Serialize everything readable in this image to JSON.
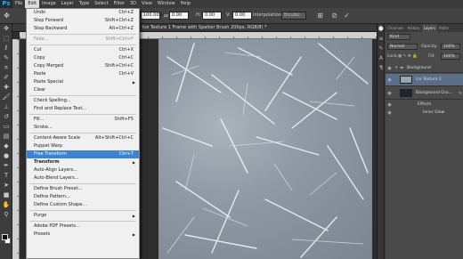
{
  "app": {
    "logo": "Ps"
  },
  "menubar": [
    "File",
    "Edit",
    "Image",
    "Layer",
    "Type",
    "Select",
    "Filter",
    "3D",
    "View",
    "Window",
    "Help"
  ],
  "options": {
    "w_value": "100.00%",
    "angle_value": "0.00",
    "h_value": "0.00",
    "h_label": "H:",
    "v_value": "0.00",
    "v_label": "V:",
    "interpolation_label": "Interpolation:",
    "interpolation_value": "Bicubic"
  },
  "document": {
    "tab_title": "Ice Texture 1  Frame with Spatter Brush 200px, RGB/8) *",
    "close_glyph": "×"
  },
  "edit_menu": {
    "items": [
      {
        "label": "Undo",
        "shortcut": "Ctrl+Z",
        "state": "normal"
      },
      {
        "label": "Step Forward",
        "shortcut": "Shift+Ctrl+Z",
        "state": "normal"
      },
      {
        "label": "Step Backward",
        "shortcut": "Alt+Ctrl+Z",
        "state": "normal"
      },
      {
        "sep": true
      },
      {
        "label": "Fade...",
        "shortcut": "Shift+Ctrl+F",
        "state": "disabled"
      },
      {
        "sep": true
      },
      {
        "label": "Cut",
        "shortcut": "Ctrl+X",
        "state": "normal"
      },
      {
        "label": "Copy",
        "shortcut": "Ctrl+C",
        "state": "normal"
      },
      {
        "label": "Copy Merged",
        "shortcut": "Shift+Ctrl+C",
        "state": "normal"
      },
      {
        "label": "Paste",
        "shortcut": "Ctrl+V",
        "state": "normal"
      },
      {
        "label": "Paste Special",
        "shortcut": "",
        "state": "normal",
        "arrow": true
      },
      {
        "label": "Clear",
        "shortcut": "",
        "state": "normal"
      },
      {
        "sep": true
      },
      {
        "label": "Check Spelling...",
        "shortcut": "",
        "state": "normal"
      },
      {
        "label": "Find and Replace Text...",
        "shortcut": "",
        "state": "normal"
      },
      {
        "sep": true
      },
      {
        "label": "Fill...",
        "shortcut": "Shift+F5",
        "state": "normal"
      },
      {
        "label": "Stroke...",
        "shortcut": "",
        "state": "normal"
      },
      {
        "sep": true
      },
      {
        "label": "Content-Aware Scale",
        "shortcut": "Alt+Shift+Ctrl+C",
        "state": "normal"
      },
      {
        "label": "Puppet Warp",
        "shortcut": "",
        "state": "normal"
      },
      {
        "label": "Free Transform",
        "shortcut": "Ctrl+T",
        "state": "highlighted"
      },
      {
        "label": "Transform",
        "shortcut": "",
        "state": "bold",
        "arrow": true
      },
      {
        "label": "Auto-Align Layers...",
        "shortcut": "",
        "state": "normal"
      },
      {
        "label": "Auto-Blend Layers...",
        "shortcut": "",
        "state": "normal"
      },
      {
        "sep": true
      },
      {
        "label": "Define Brush Preset...",
        "shortcut": "",
        "state": "normal"
      },
      {
        "label": "Define Pattern...",
        "shortcut": "",
        "state": "normal"
      },
      {
        "label": "Define Custom Shape...",
        "shortcut": "",
        "state": "normal"
      },
      {
        "sep": true
      },
      {
        "label": "Purge",
        "shortcut": "",
        "state": "normal",
        "arrow": true
      },
      {
        "sep": true
      },
      {
        "label": "Adobe PDF Presets...",
        "shortcut": "",
        "state": "normal"
      },
      {
        "label": "Presets",
        "shortcut": "",
        "state": "normal",
        "arrow": true
      }
    ]
  },
  "panels": {
    "tabs": [
      "Channels",
      "History",
      "Layers",
      "Paths"
    ],
    "active_tab": "Layers",
    "kind_label": "Kind",
    "blend_mode": "Normal",
    "opacity_label": "Opacity:",
    "opacity_value": "100%",
    "lock_label": "Lock:",
    "fill_label": "Fill:",
    "fill_value": "100%",
    "layers": [
      {
        "name": "Background",
        "type": "group"
      },
      {
        "name": "Ice Texture 1",
        "type": "layer",
        "selected": true
      },
      {
        "name": "Background Gra...",
        "type": "layer"
      },
      {
        "name": "Effects",
        "type": "effect"
      },
      {
        "name": "Inner Glow",
        "type": "effect-item"
      }
    ]
  },
  "colors": {
    "menu_highlight": "#3a84d6",
    "ps_blue": "#2fa7f2",
    "ice_base": "#8e99a3"
  }
}
